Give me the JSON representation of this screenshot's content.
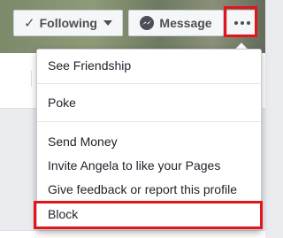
{
  "header": {
    "following_label": "Following",
    "message_label": "Message",
    "more_icon": "more-horizontal-icon"
  },
  "menu": {
    "items": [
      {
        "label": "See Friendship"
      },
      {
        "label": "Poke"
      },
      {
        "label": "Send Money"
      },
      {
        "label": "Invite Angela to like your Pages"
      },
      {
        "label": "Give feedback or report this profile"
      },
      {
        "label": "Block"
      }
    ]
  },
  "colors": {
    "highlight": "#e4141b",
    "button_text": "#4b4f56",
    "menu_text": "#1d2129"
  }
}
